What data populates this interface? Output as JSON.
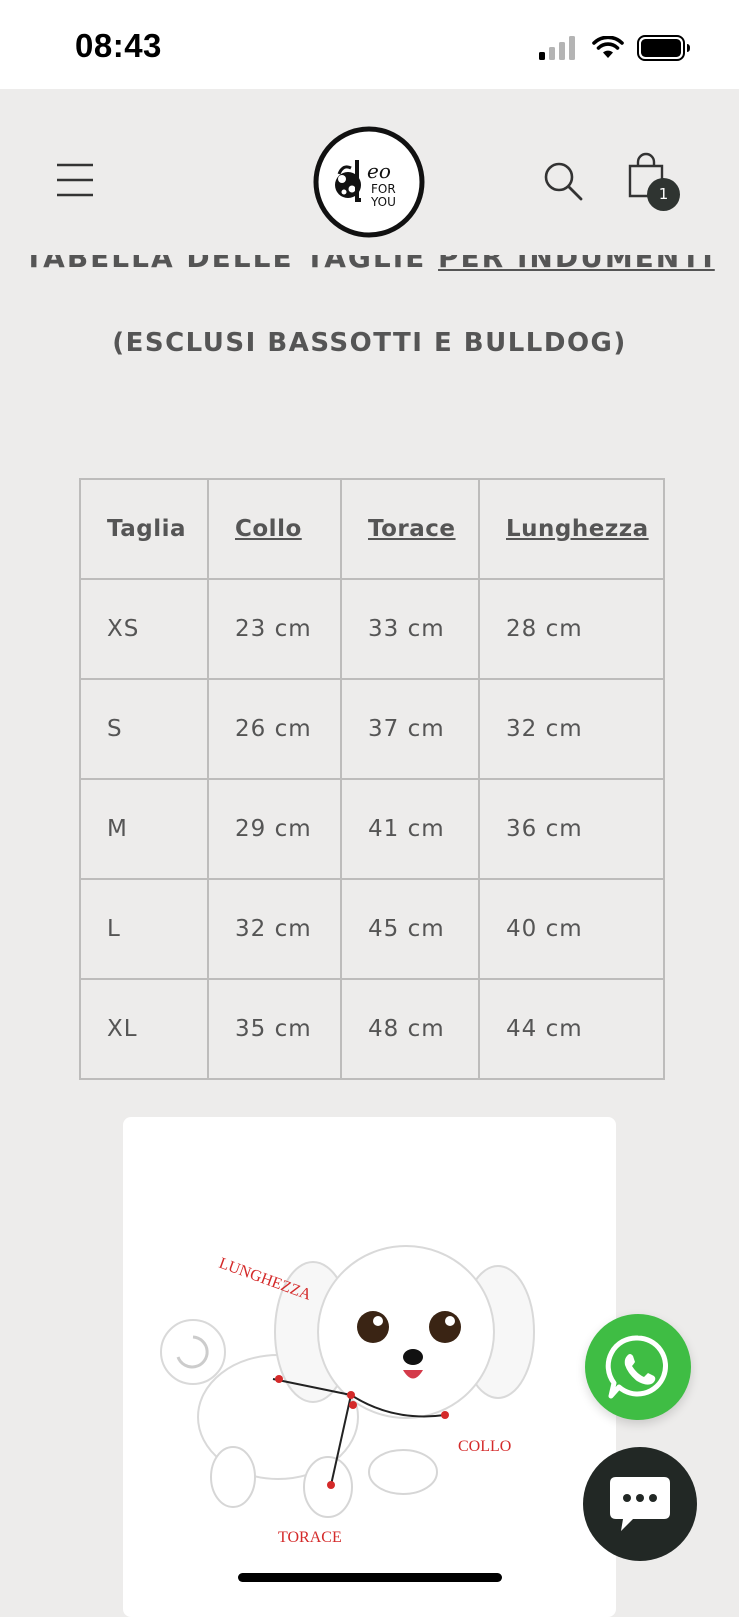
{
  "status_bar": {
    "time": "08:43"
  },
  "header": {
    "cart_count": "1",
    "logo_text": "Leo FOR YOU"
  },
  "content": {
    "title_part1": "TABELLA DELLE TAGLIE ",
    "title_part2": "PER INDUMENTI",
    "subtitle": "(ESCLUSI BASSOTTI E BULLDOG)"
  },
  "size_table": {
    "headers": [
      "Taglia",
      "Collo",
      "Torace",
      "Lunghezza"
    ],
    "rows": [
      [
        "XS",
        "23 cm",
        "33 cm",
        "28 cm"
      ],
      [
        "S",
        "26 cm",
        "37 cm",
        "32 cm"
      ],
      [
        "M",
        "29 cm",
        "41 cm",
        "36 cm"
      ],
      [
        "L",
        "32 cm",
        "45 cm",
        "40 cm"
      ],
      [
        "XL",
        "35 cm",
        "48 cm",
        "44 cm"
      ]
    ]
  },
  "measurement_image": {
    "label_length": "LUNGHEZZA",
    "label_neck": "COLLO",
    "label_chest": "TORACE"
  },
  "colors": {
    "background": "#edeceb",
    "whatsapp": "#3fbd44",
    "chat": "#222825",
    "measure_red": "#d42a2a"
  }
}
